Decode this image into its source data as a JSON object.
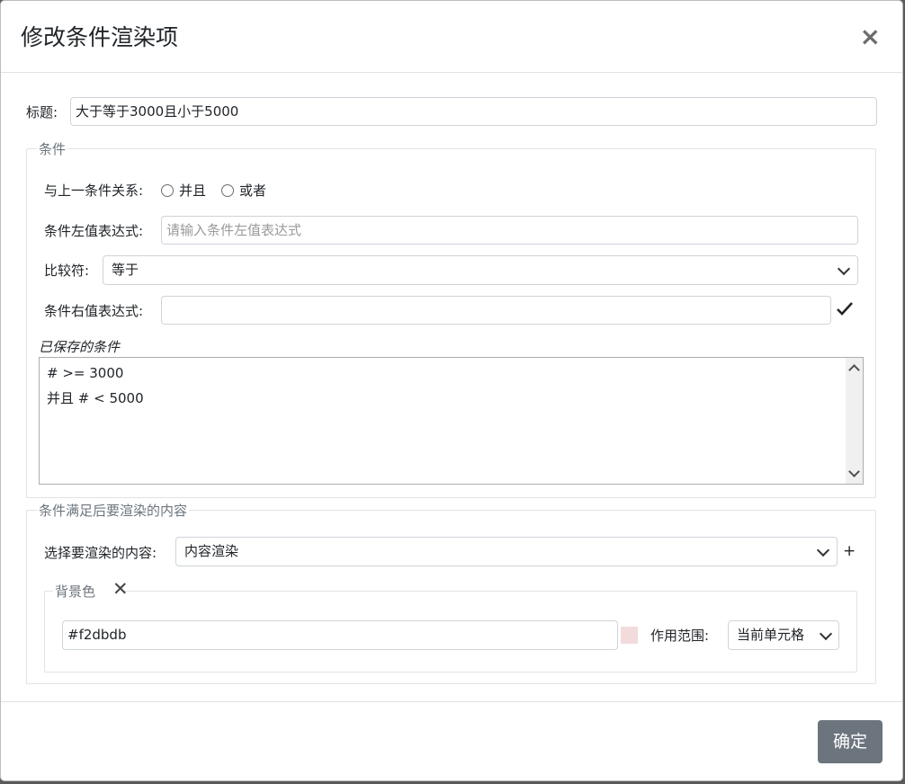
{
  "dialog": {
    "title": "修改条件渲染项",
    "close_glyph": "×"
  },
  "title_field": {
    "label": "标题:",
    "value": "大于等于3000且小于5000"
  },
  "condition": {
    "legend": "条件",
    "relation_label": "与上一条件关系:",
    "relation_options": [
      "并且",
      "或者"
    ],
    "left_expr_label": "条件左值表达式:",
    "left_expr_placeholder": "请输入条件左值表达式",
    "comparator_label": "比较符:",
    "comparator_value": "等于",
    "right_expr_label": "条件右值表达式:",
    "right_expr_value": "",
    "confirm_icon": "check-icon",
    "saved_label": "已保存的条件",
    "saved_lines": [
      "# >= 3000",
      "并且 # < 5000"
    ]
  },
  "render": {
    "legend": "条件满足后要渲染的内容",
    "select_label": "选择要渲染的内容:",
    "select_value": "内容渲染",
    "add_glyph": "+",
    "background": {
      "legend": "背景色",
      "remove_glyph": "✕",
      "color_value": "#f2dbdb",
      "swatch_color": "#f2dbdb",
      "scope_label": "作用范围:",
      "scope_value": "当前单元格"
    }
  },
  "footer": {
    "confirm_label": "确定"
  }
}
